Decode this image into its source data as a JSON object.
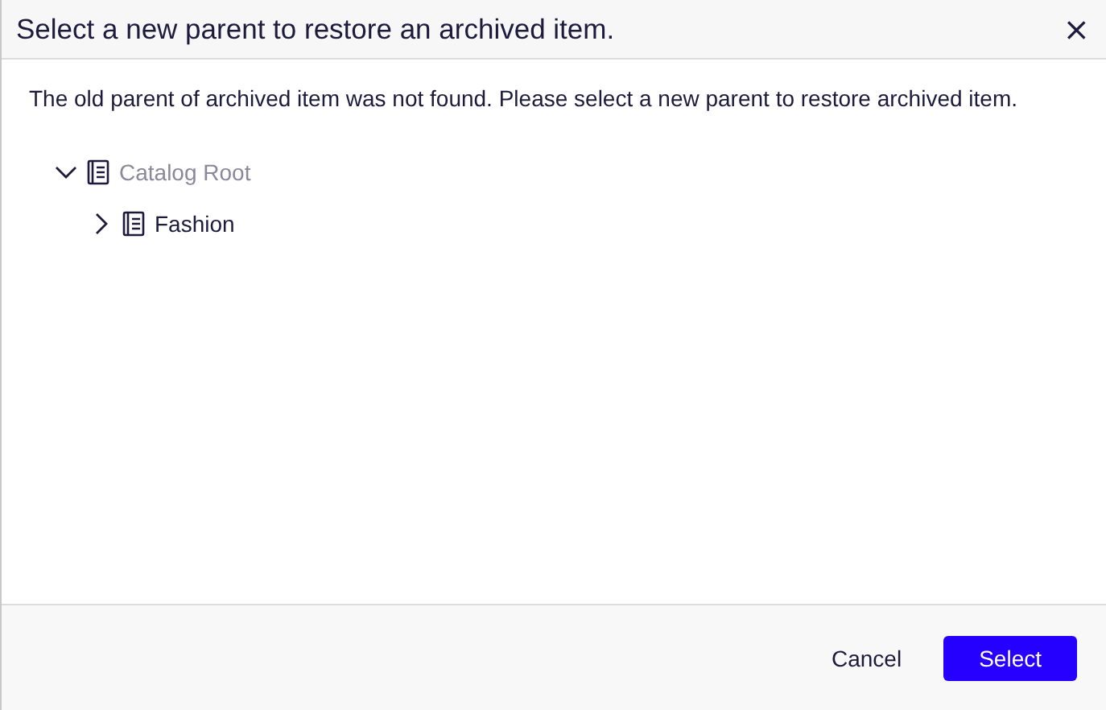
{
  "dialog": {
    "title": "Select a new parent to restore an archived item.",
    "close": "×",
    "message": "The old parent of archived item was not found. Please select a new parent to restore archived item.",
    "tree": [
      {
        "label": "Catalog Root",
        "expanded": true,
        "disabled": true,
        "children": [
          {
            "label": "Fashion",
            "expanded": false,
            "disabled": false
          }
        ]
      }
    ],
    "buttons": [
      {
        "label": "Cancel",
        "kind": "secondary"
      },
      {
        "label": "Select",
        "kind": "primary"
      }
    ]
  }
}
